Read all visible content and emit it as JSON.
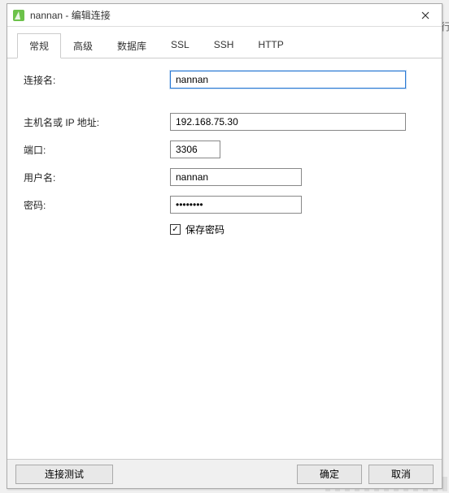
{
  "side_char": "行",
  "titlebar": {
    "title": "nannan - 编辑连接"
  },
  "tabs": {
    "general": "常规",
    "advanced": "高级",
    "database": "数据库",
    "ssl": "SSL",
    "ssh": "SSH",
    "http": "HTTP"
  },
  "form": {
    "conn_name_label": "连接名:",
    "conn_name_value": "nannan",
    "host_label": "主机名或 IP 地址:",
    "host_value": "192.168.75.30",
    "port_label": "端口:",
    "port_value": "3306",
    "user_label": "用户名:",
    "user_value": "nannan",
    "password_label": "密码:",
    "password_value": "••••••••",
    "save_password_label": "保存密码",
    "save_password_checked": true
  },
  "footer": {
    "test_label": "连接测试",
    "ok_label": "确定",
    "cancel_label": "取消"
  }
}
